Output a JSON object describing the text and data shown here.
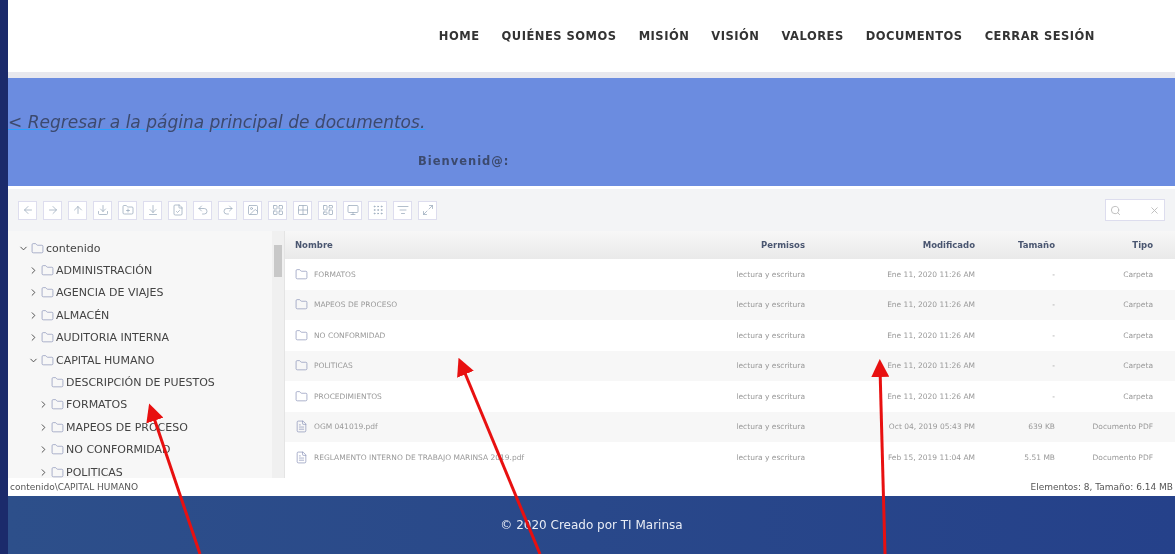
{
  "nav": {
    "items": [
      "HOME",
      "QUIÉNES SOMOS",
      "MISIÓN",
      "VISIÓN",
      "VALORES",
      "DOCUMENTOS",
      "CERRAR SESIÓN"
    ]
  },
  "banner": {
    "back_link": "< Regresar a la página principal de documentos.",
    "welcome": "Bienvenid@:"
  },
  "tree": [
    {
      "label": "contenido",
      "expandable": true,
      "expanded": true,
      "children": [
        {
          "label": "ADMINISTRACIÓN",
          "expandable": true,
          "expanded": false
        },
        {
          "label": "AGENCIA DE VIAJES",
          "expandable": true,
          "expanded": false
        },
        {
          "label": "ALMACÉN",
          "expandable": true,
          "expanded": false
        },
        {
          "label": "AUDITORIA INTERNA",
          "expandable": true,
          "expanded": false
        },
        {
          "label": "CAPITAL HUMANO",
          "expandable": true,
          "expanded": true,
          "children": [
            {
              "label": "DESCRIPCIÓN DE PUESTOS",
              "expandable": false
            },
            {
              "label": "FORMATOS",
              "expandable": true,
              "expanded": false
            },
            {
              "label": "MAPEOS DE PROCESO",
              "expandable": true,
              "expanded": false
            },
            {
              "label": "NO CONFORMIDAD",
              "expandable": true,
              "expanded": false
            },
            {
              "label": "POLITICAS",
              "expandable": true,
              "expanded": false
            }
          ]
        }
      ]
    }
  ],
  "table": {
    "columns": [
      "Nombre",
      "Permisos",
      "Modificado",
      "Tamaño",
      "Tipo"
    ],
    "rows": [
      {
        "kind": "folder",
        "name": "FORMATOS",
        "permissions": "lectura y escritura",
        "modified": "Ene 11, 2020 11:26 AM",
        "size": "-",
        "type": "Carpeta"
      },
      {
        "kind": "folder",
        "name": "MAPEOS DE PROCESO",
        "permissions": "lectura y escritura",
        "modified": "Ene 11, 2020 11:26 AM",
        "size": "-",
        "type": "Carpeta"
      },
      {
        "kind": "folder",
        "name": "NO CONFORMIDAD",
        "permissions": "lectura y escritura",
        "modified": "Ene 11, 2020 11:26 AM",
        "size": "-",
        "type": "Carpeta"
      },
      {
        "kind": "folder",
        "name": "POLITICAS",
        "permissions": "lectura y escritura",
        "modified": "Ene 11, 2020 11:26 AM",
        "size": "-",
        "type": "Carpeta"
      },
      {
        "kind": "folder",
        "name": "PROCEDIMIENTOS",
        "permissions": "lectura y escritura",
        "modified": "Ene 11, 2020 11:26 AM",
        "size": "-",
        "type": "Carpeta"
      },
      {
        "kind": "pdf",
        "name": "OGM 041019.pdf",
        "permissions": "lectura y escritura",
        "modified": "Oct 04, 2019 05:43 PM",
        "size": "639 KB",
        "type": "Documento PDF"
      },
      {
        "kind": "pdf",
        "name": "REGLAMENTO INTERNO DE TRABAJO MARINSA 2019.pdf",
        "permissions": "lectura y escritura",
        "modified": "Feb 15, 2019 11:04 AM",
        "size": "5.51 MB",
        "type": "Documento PDF"
      }
    ]
  },
  "status_bar": {
    "path": "contenido\\CAPITAL HUMANO",
    "summary": "Elementos: 8, Tamaño: 6.14 MB"
  },
  "footer": {
    "text": "© 2020 Creado por TI Marinsa"
  }
}
